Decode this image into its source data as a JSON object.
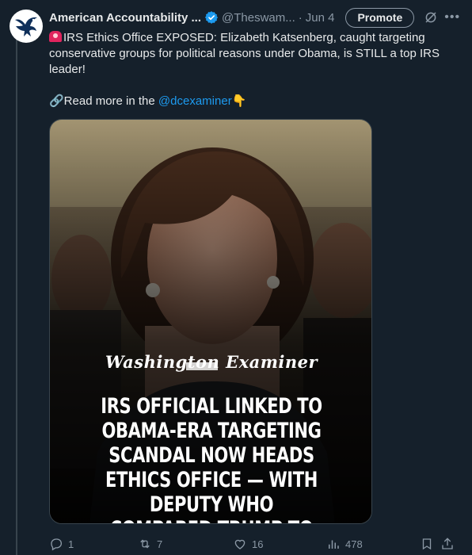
{
  "tweet": {
    "author_name": "American Accountability ...",
    "handle": "@Theswam...",
    "separator": "·",
    "date": "Jun 4",
    "promote_label": "Promote",
    "text_line1": "IRS Ethics Office EXPOSED: Elizabeth Katsenberg, caught targeting conservative groups for political reasons under Obama, is STILL a top IRS leader!",
    "read_more_prefix": "🔗Read more in the ",
    "read_more_link": "@dcexaminer",
    "read_more_suffix": "👇"
  },
  "media": {
    "brand": "Washington Examiner",
    "headline": "IRS OFFICIAL LINKED TO OBAMA-ERA TARGETING SCANDAL NOW HEADS ETHICS OFFICE — WITH DEPUTY WHO COMPARED TRUMP TO HITLER"
  },
  "actions": {
    "replies": "1",
    "reposts": "7",
    "likes": "16",
    "views": "478"
  },
  "colors": {
    "background": "#15202b",
    "accent": "#1d9bf0",
    "muted": "#8b98a5"
  },
  "icons": [
    "eagle-logo-icon",
    "verified-badge-icon",
    "grok-icon",
    "more-icon",
    "reply-icon",
    "repost-icon",
    "like-icon",
    "views-icon",
    "bookmark-icon",
    "share-icon"
  ]
}
